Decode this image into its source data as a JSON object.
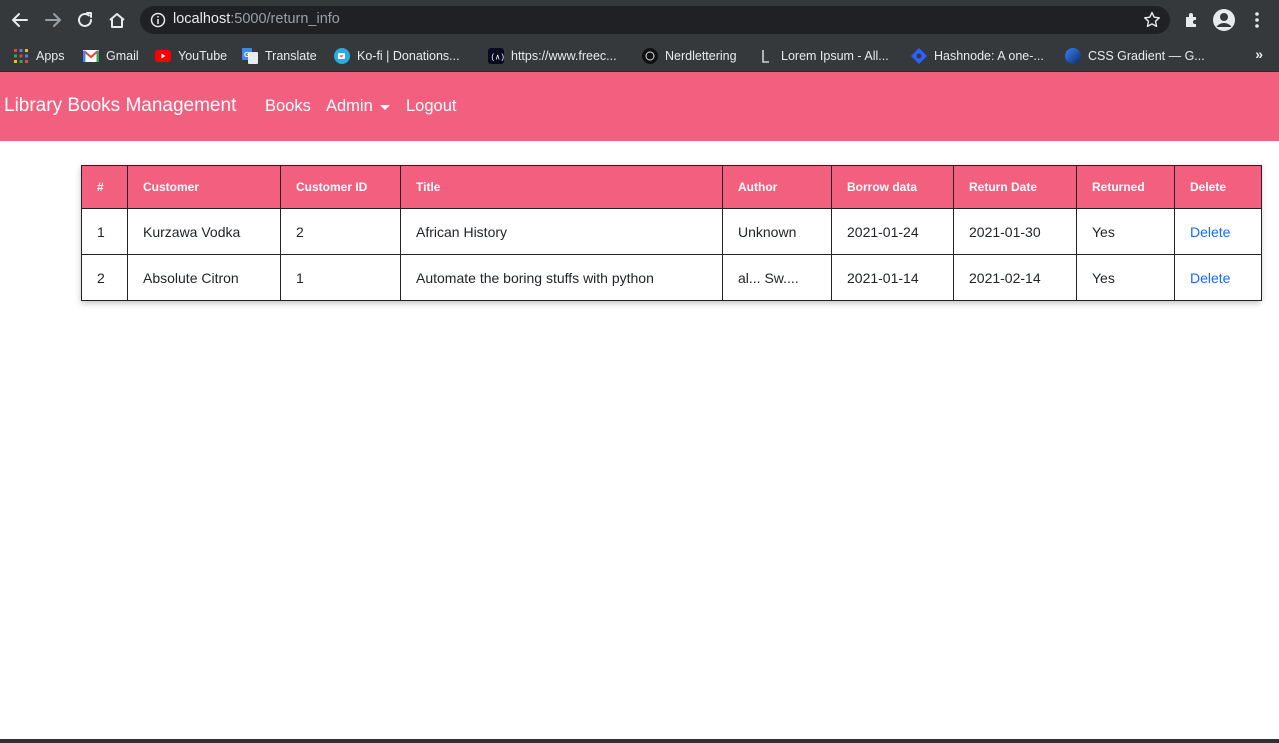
{
  "browser": {
    "url_host": "localhost",
    "url_path": ":5000/return_info",
    "bookmarks": [
      {
        "label": "Apps",
        "icon": "apps-grid-icon"
      },
      {
        "label": "Gmail",
        "icon": "gmail-icon"
      },
      {
        "label": "YouTube",
        "icon": "youtube-icon"
      },
      {
        "label": "Translate",
        "icon": "translate-icon"
      },
      {
        "label": "Ko-fi | Donations...",
        "icon": "kofi-icon"
      },
      {
        "label": "https://www.freec...",
        "icon": "freecodecamp-icon"
      },
      {
        "label": "Nerdlettering",
        "icon": "nerdlettering-icon"
      },
      {
        "label": "Lorem Ipsum - All...",
        "icon": "lorem-ipsum-icon"
      },
      {
        "label": "Hashnode: A one-...",
        "icon": "hashnode-icon"
      },
      {
        "label": "CSS Gradient — G...",
        "icon": "css-gradient-icon"
      }
    ],
    "more_label": "»"
  },
  "navbar": {
    "brand": "Library Books Management",
    "links": {
      "books": "Books",
      "admin": "Admin",
      "logout": "Logout"
    }
  },
  "table": {
    "headers": [
      "#",
      "Customer",
      "Customer ID",
      "Title",
      "Author",
      "Borrow data",
      "Return Date",
      "Returned",
      "Delete"
    ],
    "rows": [
      [
        "1",
        "Kurzawa Vodka",
        "2",
        "African History",
        "Unknown",
        "2021-01-24",
        "2021-01-30",
        "Yes",
        "Delete"
      ],
      [
        "2",
        "Absolute Citron",
        "1",
        "Automate the boring stuffs with python",
        "al... Sw....",
        "2021-01-14",
        "2021-02-14",
        "Yes",
        "Delete"
      ]
    ]
  },
  "colors": {
    "brand_pink": "#f25f7f",
    "link_blue": "#0d6efd",
    "chrome_dark": "#35393c"
  }
}
